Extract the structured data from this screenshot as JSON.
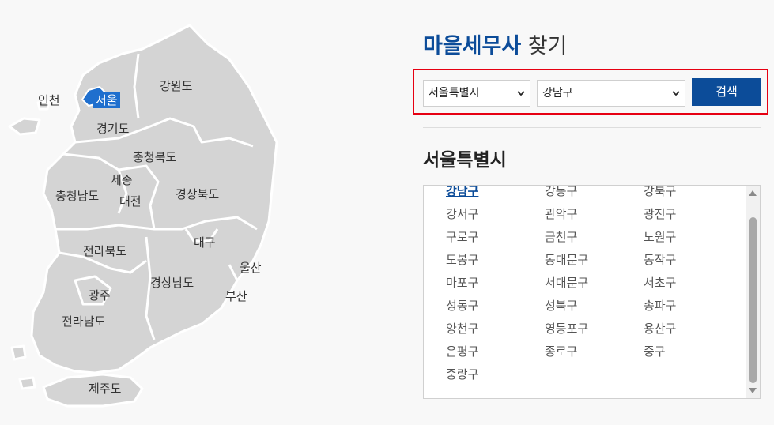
{
  "map": {
    "regions": {
      "incheon": "인천",
      "seoul": "서울",
      "gangwon": "강원도",
      "gyeonggi": "경기도",
      "chungbuk": "충청북도",
      "sejong": "세종",
      "chungnam": "충청남도",
      "daejeon": "대전",
      "gyeongbuk": "경상북도",
      "daegu": "대구",
      "jeonbuk": "전라북도",
      "ulsan": "울산",
      "gwangju": "광주",
      "gyeongnam": "경상남도",
      "busan": "부산",
      "jeonnam": "전라남도",
      "jeju": "제주도"
    },
    "land_color": "#d4d4d4",
    "selected_color": "#1f6fce"
  },
  "header": {
    "title_accent": "마을세무사",
    "title_rest": " 찾기"
  },
  "search": {
    "province_value": "서울특별시",
    "district_value": "강남구",
    "button_label": "검색"
  },
  "section": {
    "title": "서울특별시"
  },
  "districts": [
    "강남구",
    "강동구",
    "강북구",
    "강서구",
    "관악구",
    "광진구",
    "구로구",
    "금천구",
    "노원구",
    "도봉구",
    "동대문구",
    "동작구",
    "마포구",
    "서대문구",
    "서초구",
    "성동구",
    "성북구",
    "송파구",
    "양천구",
    "영등포구",
    "용산구",
    "은평구",
    "종로구",
    "중구",
    "중랑구"
  ],
  "selected_district": "강남구",
  "colors": {
    "accent": "#0c4c99",
    "highlight_border": "#e60012"
  }
}
